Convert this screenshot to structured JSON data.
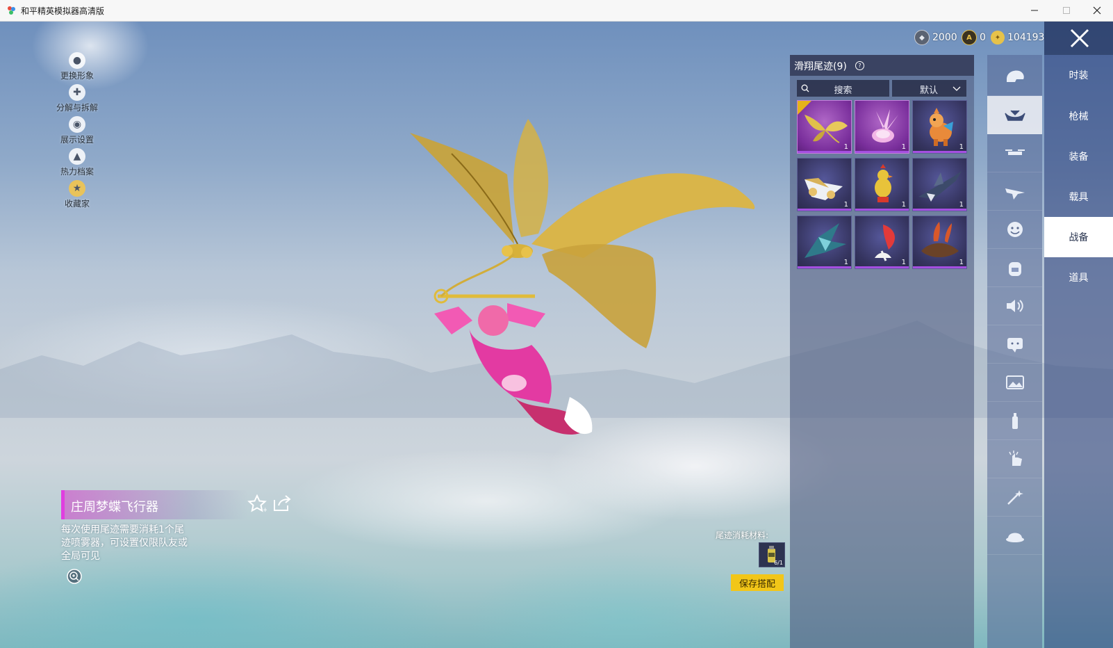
{
  "window": {
    "title": "和平精英模拟器高清版"
  },
  "currency": [
    {
      "icon": "silver-coin-icon",
      "value": "2000"
    },
    {
      "icon": "gold-coin-icon",
      "value": "0"
    },
    {
      "icon": "token-icon",
      "value": "104193"
    }
  ],
  "left_menu": [
    {
      "label": "更换形象",
      "icon": "avatar-icon"
    },
    {
      "label": "分解与拆解",
      "icon": "puzzle-icon"
    },
    {
      "label": "展示设置",
      "icon": "eye-icon"
    },
    {
      "label": "热力档案",
      "icon": "flame-icon"
    },
    {
      "label": "收藏家",
      "icon": "collector-badge-icon"
    }
  ],
  "item": {
    "name": "庄周梦蝶飞行器",
    "description": "每次使用尾迹需要消耗1个尾迹喷雾器，可设置仅限队友或全局可见"
  },
  "consume": {
    "label": "尾迹消耗材料:",
    "count": "6/1"
  },
  "save_button": "保存搭配",
  "panel": {
    "title": "滑翔尾迹(9)",
    "search_label": "搜索",
    "sort_label": "默认",
    "items": [
      {
        "art": "golden-butterfly",
        "qty": "1",
        "selected": true
      },
      {
        "art": "pink-crystal-flower",
        "qty": "1"
      },
      {
        "art": "orange-horse",
        "qty": "1"
      },
      {
        "art": "white-jet",
        "qty": "1"
      },
      {
        "art": "rooster-toy",
        "qty": "1"
      },
      {
        "art": "shark-jet",
        "qty": "1"
      },
      {
        "art": "teal-dragon-wing",
        "qty": "1"
      },
      {
        "art": "red-flame-spray",
        "qty": "1"
      },
      {
        "art": "bronze-rocket",
        "qty": "1"
      }
    ]
  },
  "rail_icons": [
    "helmet-icon",
    "glider-icon",
    "drone-icon",
    "plane-icon",
    "emote-icon",
    "backpack-icon",
    "speaker-icon",
    "chat-icon",
    "gallery-icon",
    "spray-icon",
    "gesture-icon",
    "sparkle-icon",
    "roast-chicken-icon"
  ],
  "tabs": [
    "时装",
    "枪械",
    "装备",
    "载具",
    "战备",
    "道具"
  ],
  "colors": {
    "accent_yellow": "#f2c618",
    "item_highlight": "#e03ee0",
    "panel_bg": "#535f82"
  }
}
